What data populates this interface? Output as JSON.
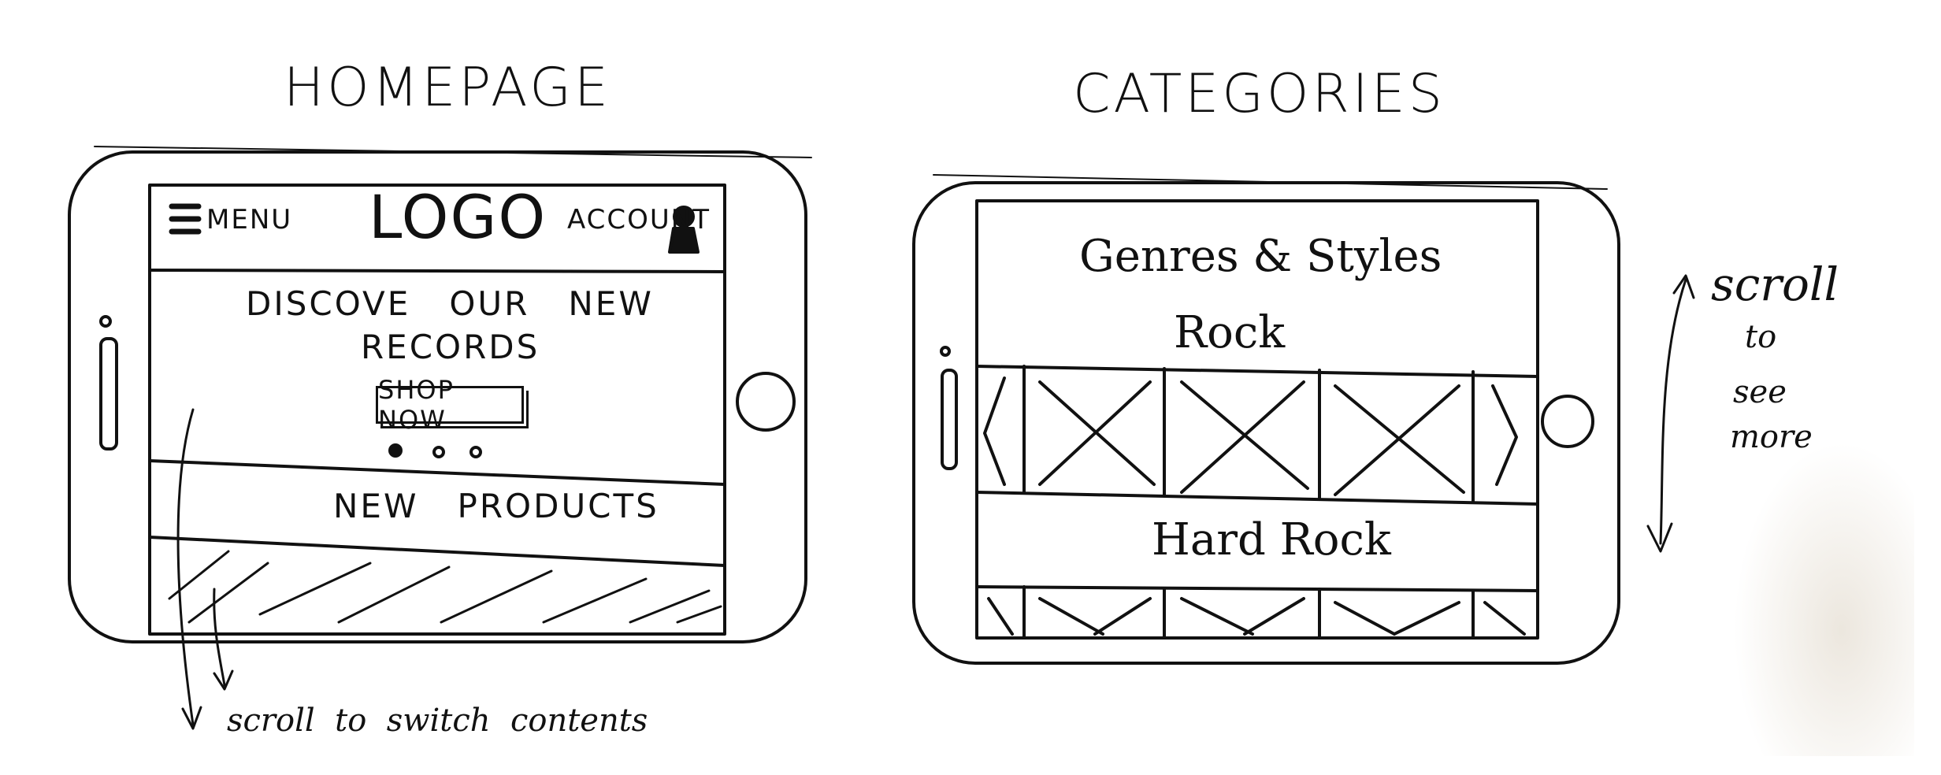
{
  "homepage": {
    "title": "HOMEPAGE",
    "header": {
      "menu_label": "MENU",
      "logo": "LOGO",
      "account_label": "ACCOUNT"
    },
    "hero": {
      "line1": "DISCOVE   OUR   NEW",
      "line2": "RECORDS",
      "cta": "SHOP NOW",
      "carousel_dots": 3,
      "active_dot": 0
    },
    "section_title": "NEW   PRODUCTS",
    "annotation": "scroll  to  switch  contents"
  },
  "categories": {
    "title": "CATEGORIES",
    "heading": "Genres & Styles",
    "genres": [
      {
        "name": "Rock"
      },
      {
        "name": "Hard Rock"
      }
    ],
    "annotation": [
      "scroll",
      "to",
      "see",
      "more"
    ]
  }
}
